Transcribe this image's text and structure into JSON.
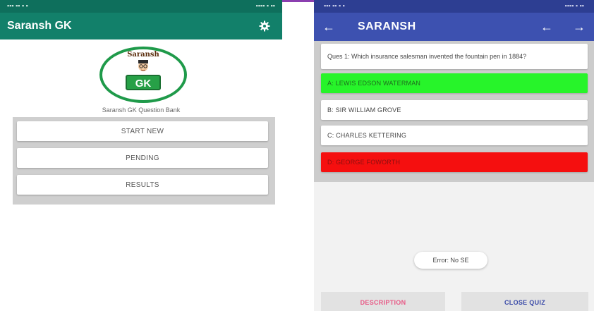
{
  "colors": {
    "left_appbar": "#12806a",
    "right_appbar": "#3d51b0",
    "correct_option": "#27f42a",
    "wrong_option": "#f50f0f",
    "logo_green": "#27a047"
  },
  "left_screen": {
    "app_title": "Saransh GK",
    "settings_icon": "gear-icon",
    "logo": {
      "top_text": "Saransh",
      "badge_text": "GK"
    },
    "caption": "Saransh GK Question Bank",
    "menu": {
      "start_new": "START NEW",
      "pending": "PENDING",
      "results": "RESULTS"
    }
  },
  "right_screen": {
    "title": "SARANSH",
    "icons": {
      "back": "arrow-left-icon",
      "prev": "arrow-left-icon",
      "next": "arrow-right-icon"
    },
    "question": "Ques 1: Which insurance salesman invented the fountain pen in 1884?",
    "options": {
      "a": "A: LEWIS EDSON WATERMAN",
      "b": "B: SIR WILLIAM GROVE",
      "c": "C: CHARLES KETTERING",
      "d": "D: GEORGE FOWORTH"
    },
    "toast": "Error: No SE",
    "buttons": {
      "description": "DESCRIPTION",
      "close_quiz": "CLOSE QUIZ"
    }
  }
}
